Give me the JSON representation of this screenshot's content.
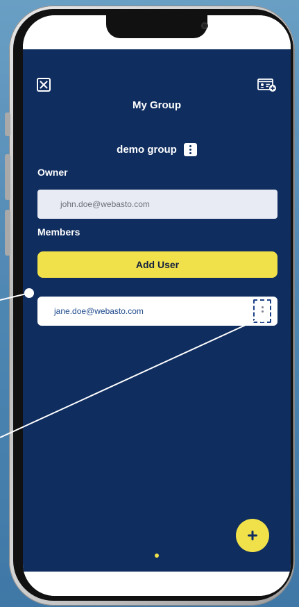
{
  "header": {
    "title": "My Group",
    "close_icon": "close-icon",
    "contact_icon": "contact-add-icon"
  },
  "group": {
    "name": "demo group",
    "menu_icon": "more-vertical-icon"
  },
  "owner": {
    "label": "Owner",
    "email": "john.doe@webasto.com"
  },
  "members": {
    "label": "Members",
    "add_button": "Add User",
    "list": [
      {
        "email": "jane.doe@webasto.com"
      }
    ]
  },
  "fab": {
    "icon": "plus-icon"
  },
  "colors": {
    "app_background": "#0f2d5f",
    "accent_yellow": "#f0e04a",
    "member_text": "#1f4a8c",
    "owner_field_bg": "#e8ebf4",
    "callout": "#ffffff"
  }
}
